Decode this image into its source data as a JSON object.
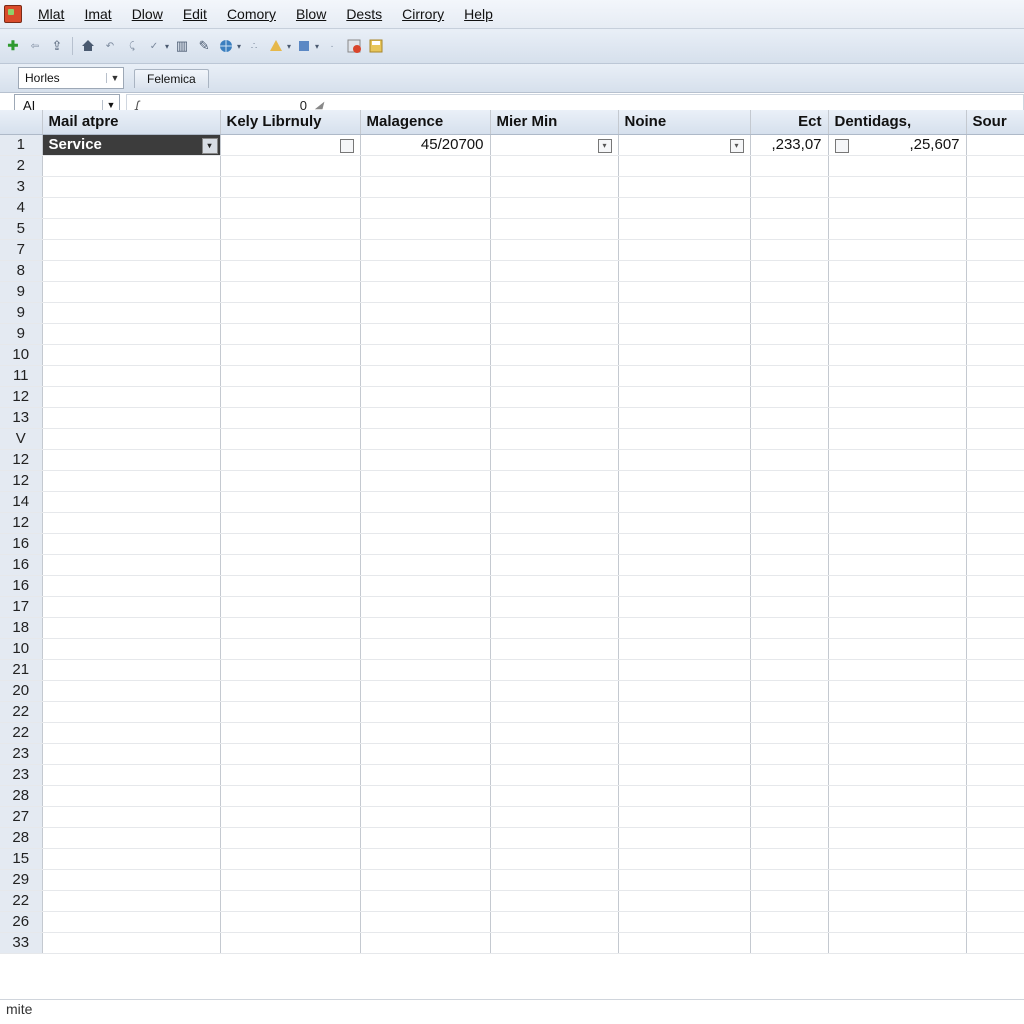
{
  "menu": [
    "Mlat",
    "Imat",
    "Dlow",
    "Edit",
    "Comory",
    "Blow",
    "Dests",
    "Cirrory",
    "Help"
  ],
  "menu_underline_index": [
    0,
    0,
    0,
    0,
    0,
    0,
    0,
    0,
    0
  ],
  "toolbar2": {
    "font_name": "Horles",
    "tab_label": "Felemica"
  },
  "formula": {
    "cell_ref": "AI",
    "value": "0"
  },
  "columns": [
    "Mail atpre",
    "Kely Librnuly",
    "Malagence",
    "Mier Min",
    "Noine",
    "Ect",
    "Dentidags,",
    "Sour"
  ],
  "row1": {
    "A": "Service",
    "C": "45/20700",
    "F": ",233,07",
    "G": ",25,607"
  },
  "row_numbers": [
    "1",
    "2",
    "3",
    "4",
    "5",
    "7",
    "8",
    "9",
    "9",
    "9",
    "10",
    "11",
    "12",
    "13",
    "V",
    "12",
    "12",
    "14",
    "12",
    "16",
    "16",
    "16",
    "17",
    "18",
    "10",
    "21",
    "20",
    "22",
    "22",
    "23",
    "23",
    "28",
    "27",
    "28",
    "15",
    "29",
    "22",
    "26",
    "33"
  ],
  "status": "mite"
}
